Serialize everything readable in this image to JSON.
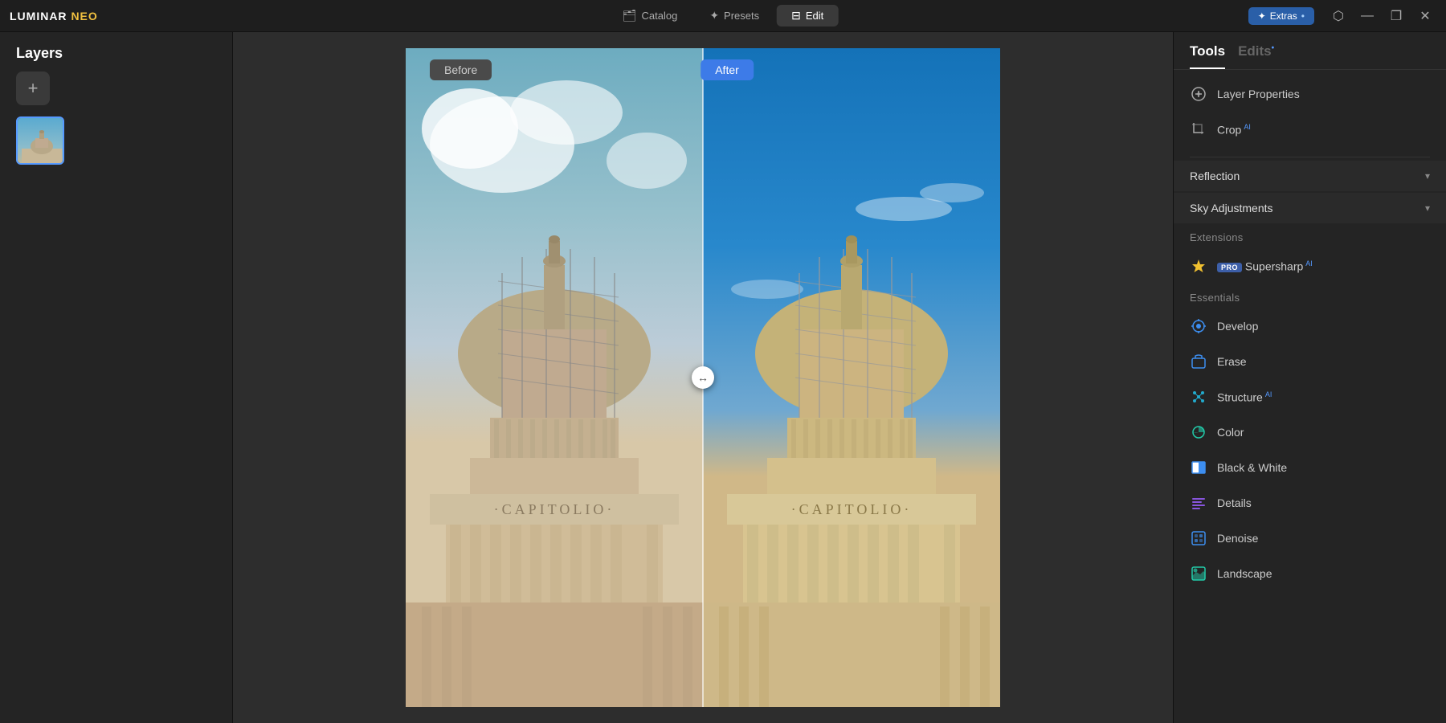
{
  "app": {
    "name": "LUMINAR",
    "name_accent": "NEO",
    "title": "Luminar Neo"
  },
  "titlebar": {
    "nav": [
      {
        "id": "catalog",
        "label": "Catalog",
        "icon": "🗂",
        "active": false
      },
      {
        "id": "presets",
        "label": "Presets",
        "icon": "✦",
        "active": false
      },
      {
        "id": "edit",
        "label": "Edit",
        "icon": "⊟",
        "active": true
      }
    ],
    "extras_label": "Extras",
    "extras_dot": "•",
    "window_controls": [
      "⬜",
      "—",
      "❐",
      "✕"
    ]
  },
  "layers": {
    "title": "Layers",
    "add_button": "+"
  },
  "canvas": {
    "before_label": "Before",
    "after_label": "After"
  },
  "tools": {
    "tabs": [
      {
        "id": "tools",
        "label": "Tools",
        "active": true
      },
      {
        "id": "edits",
        "label": "Edits",
        "dot": true,
        "active": false
      }
    ],
    "main_tools": [
      {
        "id": "layer-properties",
        "label": "Layer Properties",
        "icon": "layer",
        "color": "gray"
      },
      {
        "id": "crop",
        "label": "Crop",
        "ai": true,
        "icon": "crop",
        "color": "gray"
      }
    ],
    "collapsible_tools": [
      {
        "id": "reflection",
        "label": "Reflection",
        "expanded": false
      },
      {
        "id": "sky-adjustments",
        "label": "Sky Adjustments",
        "expanded": false
      }
    ],
    "extensions_label": "Extensions",
    "extensions": [
      {
        "id": "supersharp",
        "label": "Supersharp",
        "ai": true,
        "pro": true,
        "icon": "warning",
        "color": "yellow"
      }
    ],
    "essentials_label": "Essentials",
    "essentials": [
      {
        "id": "develop",
        "label": "Develop",
        "icon": "develop",
        "color": "blue"
      },
      {
        "id": "erase",
        "label": "Erase",
        "icon": "erase",
        "color": "blue"
      },
      {
        "id": "structure",
        "label": "Structure",
        "ai": true,
        "icon": "structure",
        "color": "cyan"
      },
      {
        "id": "color",
        "label": "Color",
        "icon": "color",
        "color": "teal"
      },
      {
        "id": "black-white",
        "label": "Black & White",
        "icon": "bw",
        "color": "blue"
      },
      {
        "id": "details",
        "label": "Details",
        "icon": "details",
        "color": "purple"
      },
      {
        "id": "denoise",
        "label": "Denoise",
        "icon": "denoise",
        "color": "blue"
      },
      {
        "id": "landscape",
        "label": "Landscape",
        "icon": "landscape",
        "color": "teal"
      }
    ]
  }
}
